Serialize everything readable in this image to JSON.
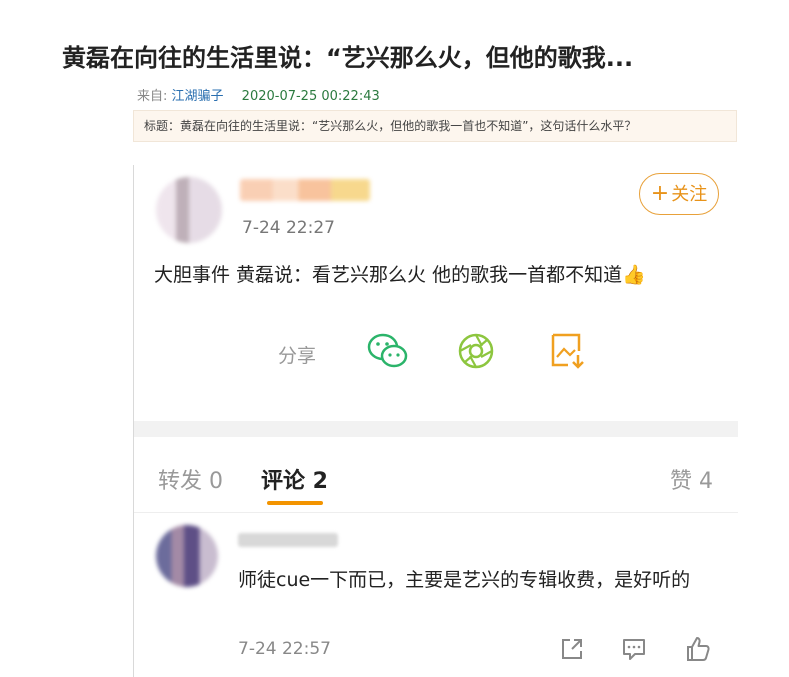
{
  "post": {
    "title": "黄磊在向往的生活里说：“艺兴那么火，但他的歌我...",
    "meta_prefix": "来自: ",
    "author": "江湖骗子",
    "datetime": "2020-07-25 00:22:43",
    "subject": "标题：黄磊在向往的生活里说：“艺兴那么火，但他的歌我一首也不知道”，这句话什么水平？"
  },
  "weibo": {
    "time": "7-24 22:27",
    "follow_label": "关注",
    "follow_plus": "+",
    "text": "大胆事件 黄磊说：看艺兴那么火 他的歌我一首都不知道👍",
    "share_label": "分享",
    "icons": [
      "wechat-icon",
      "moments-icon",
      "save-image-icon"
    ],
    "accent": "#f39400"
  },
  "tabs": {
    "repost": "转发 0",
    "comments": "评论 2",
    "likes": "赞 4"
  },
  "comment": {
    "text": "师徒cue一下而已，主要是艺兴的专辑收费，是好听的",
    "time": "7-24 22:57",
    "icons": [
      "share-out-icon",
      "reply-icon",
      "like-icon"
    ]
  }
}
